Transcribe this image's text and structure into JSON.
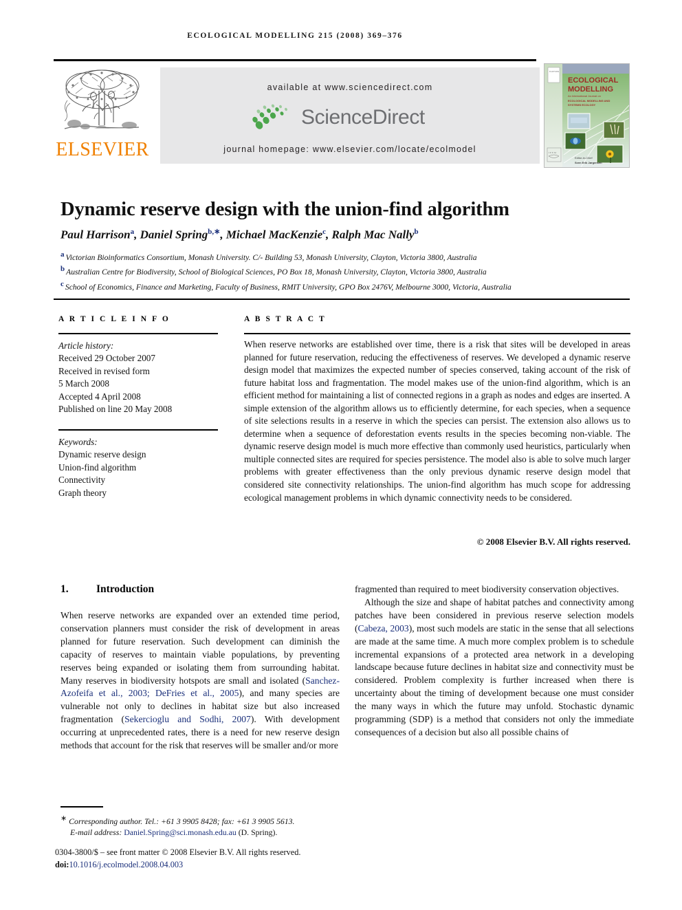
{
  "running_head": "ECOLOGICAL MODELLING 215 (2008) 369–376",
  "masthead": {
    "publisher_name": "ELSEVIER",
    "available_at": "available at www.sciencedirect.com",
    "sciencedirect_wordmark": "ScienceDirect",
    "journal_homepage": "journal homepage: www.elsevier.com/locate/ecolmodel",
    "cover": {
      "title_line1": "ECOLOGICAL",
      "title_line2": "MODELLING",
      "subtitle": "An International Journal on",
      "subtitle2": "ECOLOGICAL MODELLING AND",
      "subtitle3": "SYSTEMS ECOLOGY",
      "editor_label": "Editor-in-Chief",
      "editor_name": "Sven Erik Jørgensen"
    },
    "colors": {
      "elsevier_orange": "#F08000",
      "sciencedirect_green": "#4CA64C",
      "sciencedirect_grey": "#6d6e71",
      "band_grey": "#e7e7e8",
      "cover_green": "#7fb069",
      "cover_title_red": "#9e2b25",
      "link_blue": "#1a2f7a"
    }
  },
  "article": {
    "title": "Dynamic reserve design with the union-find algorithm",
    "authors_html": "Paul Harrison<sup>a</sup>, Daniel Spring<sup>b,∗</sup>, Michael MacKenzie<sup>c</sup>, Ralph Mac Nally<sup>b</sup>",
    "affiliations": [
      {
        "mark": "a",
        "text": "Victorian Bioinformatics Consortium, Monash University. C/- Building 53, Monash University, Clayton, Victoria 3800, Australia"
      },
      {
        "mark": "b",
        "text": "Australian Centre for Biodiversity, School of Biological Sciences, PO Box 18, Monash University, Clayton, Victoria 3800, Australia"
      },
      {
        "mark": "c",
        "text": "School of Economics, Finance and Marketing, Faculty of Business, RMIT University, GPO Box 2476V, Melbourne 3000, Victoria, Australia"
      }
    ]
  },
  "info": {
    "label": "A R T I C L E   I N F O",
    "history_heading": "Article history:",
    "history_lines": [
      "Received 29 October 2007",
      "Received in revised form",
      "5 March 2008",
      "Accepted 4 April 2008",
      "Published on line 20 May 2008"
    ],
    "keywords_heading": "Keywords:",
    "keywords": [
      "Dynamic reserve design",
      "Union-find algorithm",
      "Connectivity",
      "Graph theory"
    ]
  },
  "abstract": {
    "label": "A B S T R A C T",
    "text": "When reserve networks are established over time, there is a risk that sites will be developed in areas planned for future reservation, reducing the effectiveness of reserves. We developed a dynamic reserve design model that maximizes the expected number of species conserved, taking account of the risk of future habitat loss and fragmentation. The model makes use of the union-find algorithm, which is an efficient method for maintaining a list of connected regions in a graph as nodes and edges are inserted. A simple extension of the algorithm allows us to efficiently determine, for each species, when a sequence of site selections results in a reserve in which the species can persist. The extension also allows us to determine when a sequence of deforestation events results in the species becoming non-viable. The dynamic reserve design model is much more effective than commonly used heuristics, particularly when multiple connected sites are required for species persistence. The model also is able to solve much larger problems with greater effectiveness than the only previous dynamic reserve design model that considered site connectivity relationships. The union-find algorithm has much scope for addressing ecological management problems in which dynamic connectivity needs to be considered.",
    "copyright": "© 2008 Elsevier B.V. All rights reserved."
  },
  "body": {
    "section_number": "1.",
    "section_title": "Introduction",
    "left_col_paragraph_1_a": "When reserve networks are expanded over an extended time period, conservation planners must consider the risk of development in areas planned for future reservation. Such development can diminish the capacity of reserves to maintain viable populations, by preventing reserves being expanded or isolating them from surrounding habitat. Many reserves in biodiversity hotspots are small and isolated (",
    "left_cite_1": "Sanchez-Azofeifa et al., 2003; DeFries et al., 2005",
    "left_col_paragraph_1_b": "), and many species are vulnerable not only to declines in habitat size but also increased fragmentation (",
    "left_cite_2": "Sekercioglu and Sodhi, 2007",
    "left_col_paragraph_1_c": "). With development occurring at unprecedented rates, there is a need for new reserve design methods that account for the risk that reserves will be smaller and/or more",
    "right_col_continuation": "fragmented than required to meet biodiversity conservation objectives.",
    "right_col_paragraph_2_a": "Although the size and shape of habitat patches and connectivity among patches have been considered in previous reserve selection models (",
    "right_cite_1": "Cabeza, 2003",
    "right_col_paragraph_2_b": "), most such models are static in the sense that all selections are made at the same time. A much more complex problem is to schedule incremental expansions of a protected area network in a developing landscape because future declines in habitat size and connectivity must be considered. Problem complexity is further increased when there is uncertainty about the timing of development because one must consider the many ways in which the future may unfold. Stochastic dynamic programming (SDP) is a method that considers not only the immediate consequences of a decision but also all possible chains of"
  },
  "footer": {
    "corresponding_marker": "∗",
    "corresponding_text": "Corresponding author. Tel.: +61 3 9905 8428; fax: +61 3 9905 5613.",
    "email_label": "E-mail address:",
    "email": "Daniel.Spring@sci.monash.edu.au",
    "email_suffix": "(D. Spring).",
    "issn_line": "0304-3800/$ – see front matter © 2008 Elsevier B.V. All rights reserved.",
    "doi_label": "doi:",
    "doi": "10.1016/j.ecolmodel.2008.04.003"
  }
}
